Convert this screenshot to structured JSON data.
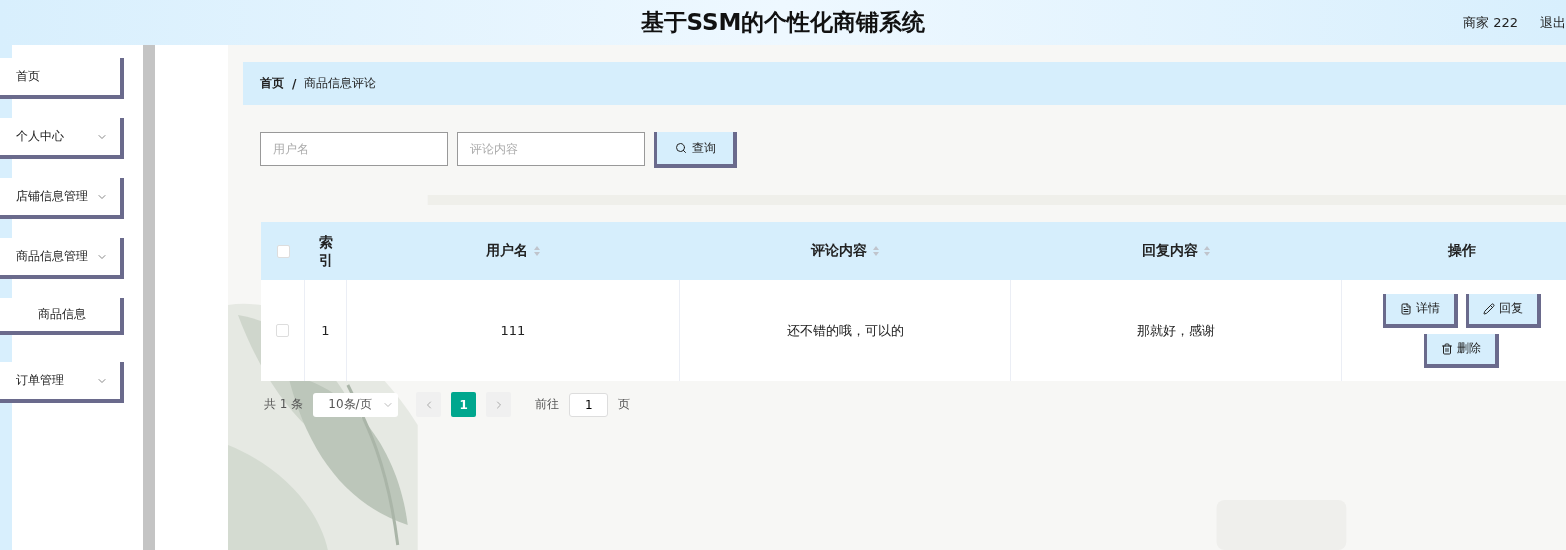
{
  "header": {
    "title": "基于SSM的个性化商铺系统",
    "user": "商家 222",
    "logout": "退出"
  },
  "sidebar": {
    "items": [
      {
        "label": "首页",
        "expandable": false
      },
      {
        "label": "个人中心",
        "expandable": true
      },
      {
        "label": "店铺信息管理",
        "expandable": true
      },
      {
        "label": "商品信息管理",
        "expandable": true,
        "children": [
          {
            "label": "商品信息"
          }
        ]
      },
      {
        "label": "订单管理",
        "expandable": true
      }
    ]
  },
  "breadcrumb": [
    "首页",
    "商品信息评论"
  ],
  "breadcrumb_separator": "/",
  "search": {
    "fields": [
      {
        "placeholder": "用户名"
      },
      {
        "placeholder": "评论内容"
      }
    ],
    "button": "查询"
  },
  "table": {
    "columns": [
      {
        "label": "索引",
        "sortable": false
      },
      {
        "label": "用户名",
        "sortable": true
      },
      {
        "label": "评论内容",
        "sortable": true
      },
      {
        "label": "回复内容",
        "sortable": true
      },
      {
        "label": "操作",
        "sortable": false
      }
    ],
    "header_checked": false,
    "rows": [
      {
        "checked": false,
        "index": "1",
        "username": "111",
        "comment": "还不错的哦，可以的",
        "reply": "那就好，感谢",
        "actions": [
          {
            "kind": "detail",
            "label": "详情"
          },
          {
            "kind": "reply",
            "label": "回复"
          },
          {
            "kind": "delete",
            "label": "删除"
          }
        ]
      }
    ]
  },
  "pagination": {
    "total": "共 1 条",
    "page_size": "10条/页",
    "pages": [
      {
        "label": "1",
        "selected": true
      }
    ],
    "goto_label": "前往",
    "goto_value": "1",
    "page_suffix": "页"
  }
}
